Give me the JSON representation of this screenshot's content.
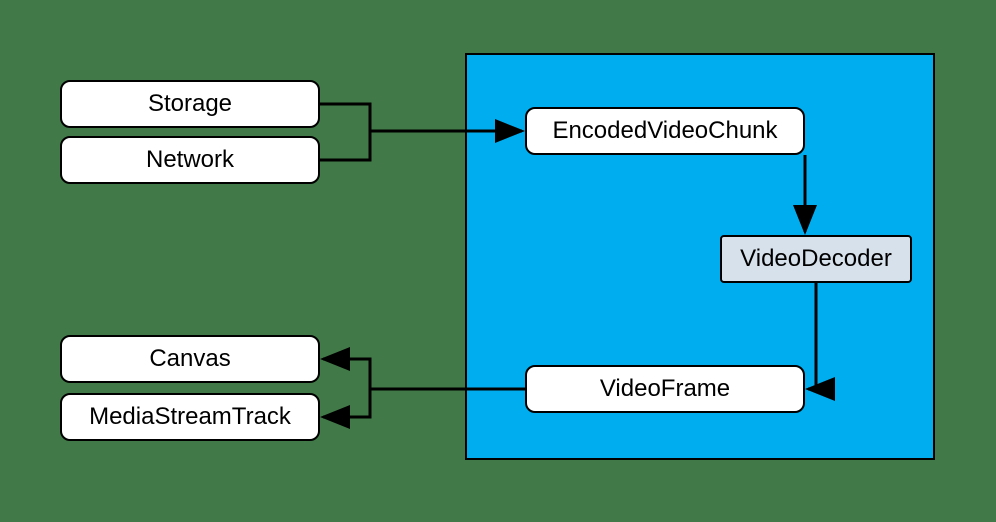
{
  "diagram": {
    "nodes": {
      "storage": "Storage",
      "network": "Network",
      "encodedVideoChunk": "EncodedVideoChunk",
      "videoDecoder": "VideoDecoder",
      "videoFrame": "VideoFrame",
      "canvas": "Canvas",
      "mediaStreamTrack": "MediaStreamTrack"
    },
    "region": {
      "highlight_color": "#00aeef"
    },
    "flow": [
      [
        "Storage",
        "EncodedVideoChunk"
      ],
      [
        "Network",
        "EncodedVideoChunk"
      ],
      [
        "EncodedVideoChunk",
        "VideoDecoder"
      ],
      [
        "VideoDecoder",
        "VideoFrame"
      ],
      [
        "VideoFrame",
        "Canvas"
      ],
      [
        "VideoFrame",
        "MediaStreamTrack"
      ]
    ]
  }
}
